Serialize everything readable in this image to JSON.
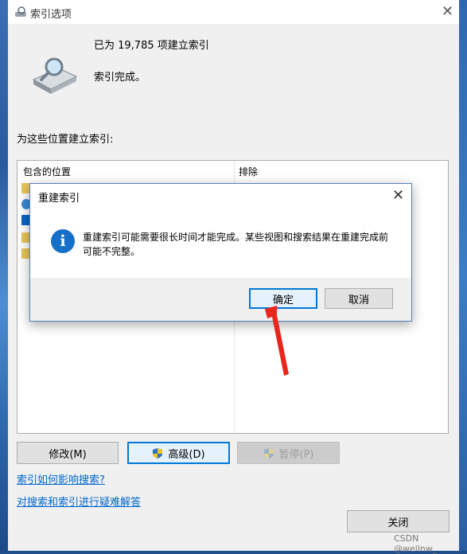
{
  "window": {
    "title": "索引选项"
  },
  "status": {
    "indexed_line": "已为 19,785 项建立索引",
    "complete_line": "索引完成。"
  },
  "list": {
    "label": "为这些位置建立索引:",
    "columns": {
      "included": "包含的位置",
      "excluded": "排除"
    }
  },
  "buttons": {
    "modify": "修改(M)",
    "advanced": "高级(D)",
    "pause": "暂停(P)",
    "close": "关闭"
  },
  "links": {
    "how_affects": "索引如何影响搜索?",
    "troubleshoot": "对搜索和索引进行疑难解答"
  },
  "dialog": {
    "title": "重建索引",
    "message": "重建索引可能需要很长时间才能完成。某些视图和搜索结果在重建完成前可能不完整。",
    "ok": "确定",
    "cancel": "取消"
  },
  "watermark": "CSDN @wellnw_",
  "colors": {
    "accent": "#0078d7",
    "info_blue": "#1770c8",
    "link": "#0066cc",
    "arrow_red": "#e8261c"
  },
  "icons": [
    "search-drive-icon",
    "info-icon",
    "shield-icon",
    "close-icon"
  ]
}
